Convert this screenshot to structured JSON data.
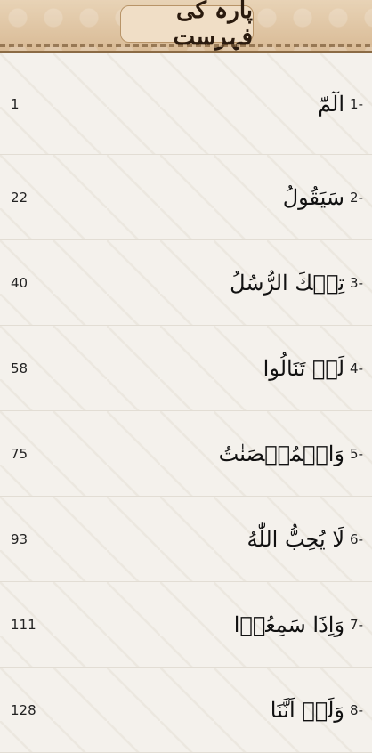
{
  "header": {
    "title": "پارہ کی فہرست"
  },
  "parahs": [
    {
      "index": "1-",
      "name": "الٓمّٓ",
      "page": "1"
    },
    {
      "index": "2-",
      "name": "سَيَقُولُ",
      "page": "22"
    },
    {
      "index": "3-",
      "name": "تِلۡكَ الرُّسُلُ",
      "page": "40"
    },
    {
      "index": "4-",
      "name": "لَنۡ تَنَالُوا",
      "page": "58"
    },
    {
      "index": "5-",
      "name": "وَالۡمُحۡصَنٰتُ",
      "page": "75"
    },
    {
      "index": "6-",
      "name": "لَا يُحِبُّ اللّٰهُ",
      "page": "93"
    },
    {
      "index": "7-",
      "name": "وَاِذَا سَمِعُوۡا",
      "page": "111"
    },
    {
      "index": "8-",
      "name": "وَلَوۡ اَنَّنَا",
      "page": "128"
    }
  ]
}
